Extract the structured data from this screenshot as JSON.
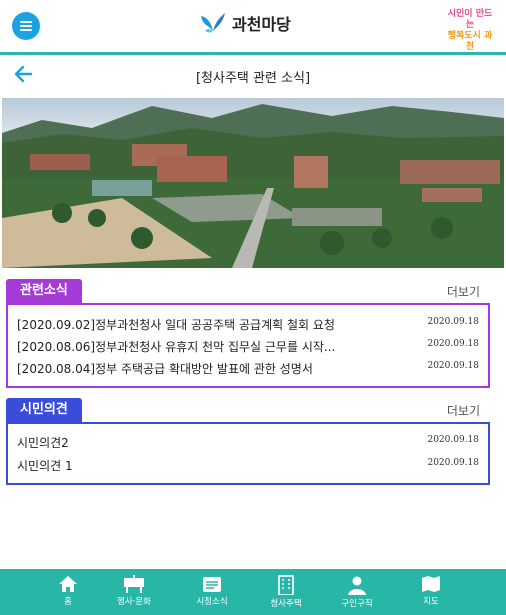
{
  "header": {
    "app_title": "과천마당",
    "brand_line1": "시민이 만드는",
    "brand_line2": "행복도시 과천"
  },
  "page": {
    "title": "[청사주택 관련 소식]"
  },
  "related_news": {
    "tag": "관련소식",
    "more": "더보기",
    "items": [
      {
        "title": "[2020.09.02]정부과천청사 일대 공공주택 공급계획 철회 요청",
        "date": "2020.09.18"
      },
      {
        "title": "[2020.08.06]정부과천청사 유휴지 천막 집무실 근무를 시작...",
        "date": "2020.09.18"
      },
      {
        "title": "[2020.08.04]정부 주택공급 확대방안 발표에 관한 성명서",
        "date": "2020.09.18"
      }
    ]
  },
  "citizen_opinion": {
    "tag": "시민의견",
    "more": "더보기",
    "items": [
      {
        "title": "시민의견2",
        "date": "2020.09.18"
      },
      {
        "title": "시민의견 1",
        "date": "2020.09.18"
      }
    ]
  },
  "bottom_nav": [
    {
      "label": "홈",
      "icon": "home-icon"
    },
    {
      "label": "행사·문화",
      "icon": "event-icon"
    },
    {
      "label": "시정소식",
      "icon": "news-icon"
    },
    {
      "label": "청사주택",
      "icon": "building-icon"
    },
    {
      "label": "구인구직",
      "icon": "person-icon"
    },
    {
      "label": "지도",
      "icon": "map-icon"
    }
  ],
  "colors": {
    "accent": "#28b7a7",
    "menu": "#1aa3e0",
    "news_tag": "#a53ad6",
    "opinion_tag": "#3b4cd8"
  }
}
